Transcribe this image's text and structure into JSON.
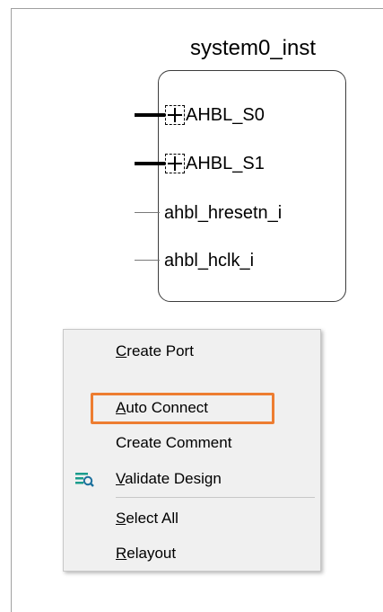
{
  "instance": {
    "name": "system0_inst",
    "pins": [
      {
        "label": "AHBL_S0",
        "kind": "bus"
      },
      {
        "label": "AHBL_S1",
        "kind": "bus"
      },
      {
        "label": "ahbl_hresetn_i",
        "kind": "signal"
      },
      {
        "label": "ahbl_hclk_i",
        "kind": "signal"
      }
    ]
  },
  "context_menu": {
    "items": [
      {
        "label": "Create Port",
        "mnemonic": "C",
        "rest": "reate Port"
      },
      {
        "label": "Auto Connect",
        "mnemonic": "A",
        "rest": "uto Connect"
      },
      {
        "label": "Create Comment",
        "mnemonic": "",
        "rest": "Create Comment"
      },
      {
        "label": "Validate Design",
        "mnemonic": "V",
        "rest": "alidate Design",
        "icon": "validate-design-icon"
      },
      {
        "label": "Select All",
        "mnemonic": "S",
        "rest": "elect All"
      },
      {
        "label": "Relayout",
        "mnemonic": "R",
        "rest": "elayout"
      }
    ],
    "highlighted_item": "Auto Connect"
  },
  "colors": {
    "highlight": "#ed7d31",
    "icon_teal": "#1a9c8c"
  }
}
